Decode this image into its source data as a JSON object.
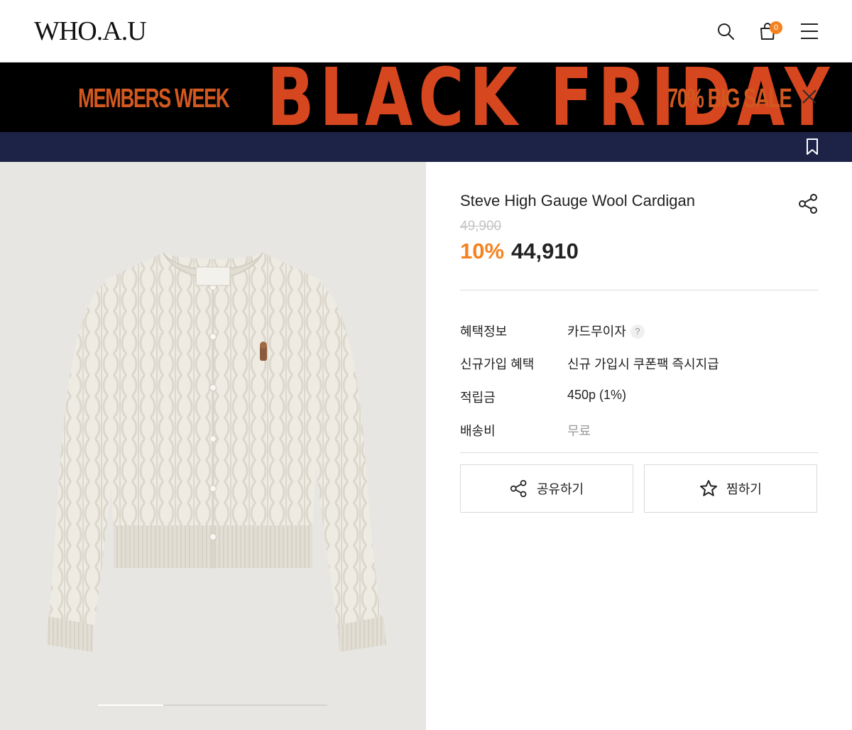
{
  "header": {
    "logo": "WHO.A.U",
    "cart_count": "0",
    "icons": [
      "search-icon",
      "cart-icon",
      "menu-icon"
    ]
  },
  "banner": {
    "left_text": "MEMBERS WEEK",
    "main_text": "BLACK FRIDAY",
    "right_text": "70% BIG SALE",
    "accent_color": "#d6461f",
    "background_color": "#000000"
  },
  "navbar": {
    "background_color": "#1d2347",
    "icon": "bookmark-icon"
  },
  "product": {
    "title": "Steve High Gauge Wool Cardigan",
    "original_price": "49,900",
    "discount": "10%",
    "price": "44,910",
    "image_count": 3,
    "active_image": 1
  },
  "details": [
    {
      "label": "혜택정보",
      "value": "카드무이자"
    },
    {
      "label": "신규가입 혜택",
      "value": "신규 가입시 쿠폰팩 즉시지급"
    },
    {
      "label": "적립금",
      "value": "450p (1%)"
    },
    {
      "label": "배송비",
      "value": "무료"
    }
  ],
  "help_mark": "?",
  "actions": {
    "share_label": "공유하기",
    "wish_label": "찜하기"
  },
  "colors": {
    "accent": "#f5821f",
    "price_text": "#222222"
  }
}
